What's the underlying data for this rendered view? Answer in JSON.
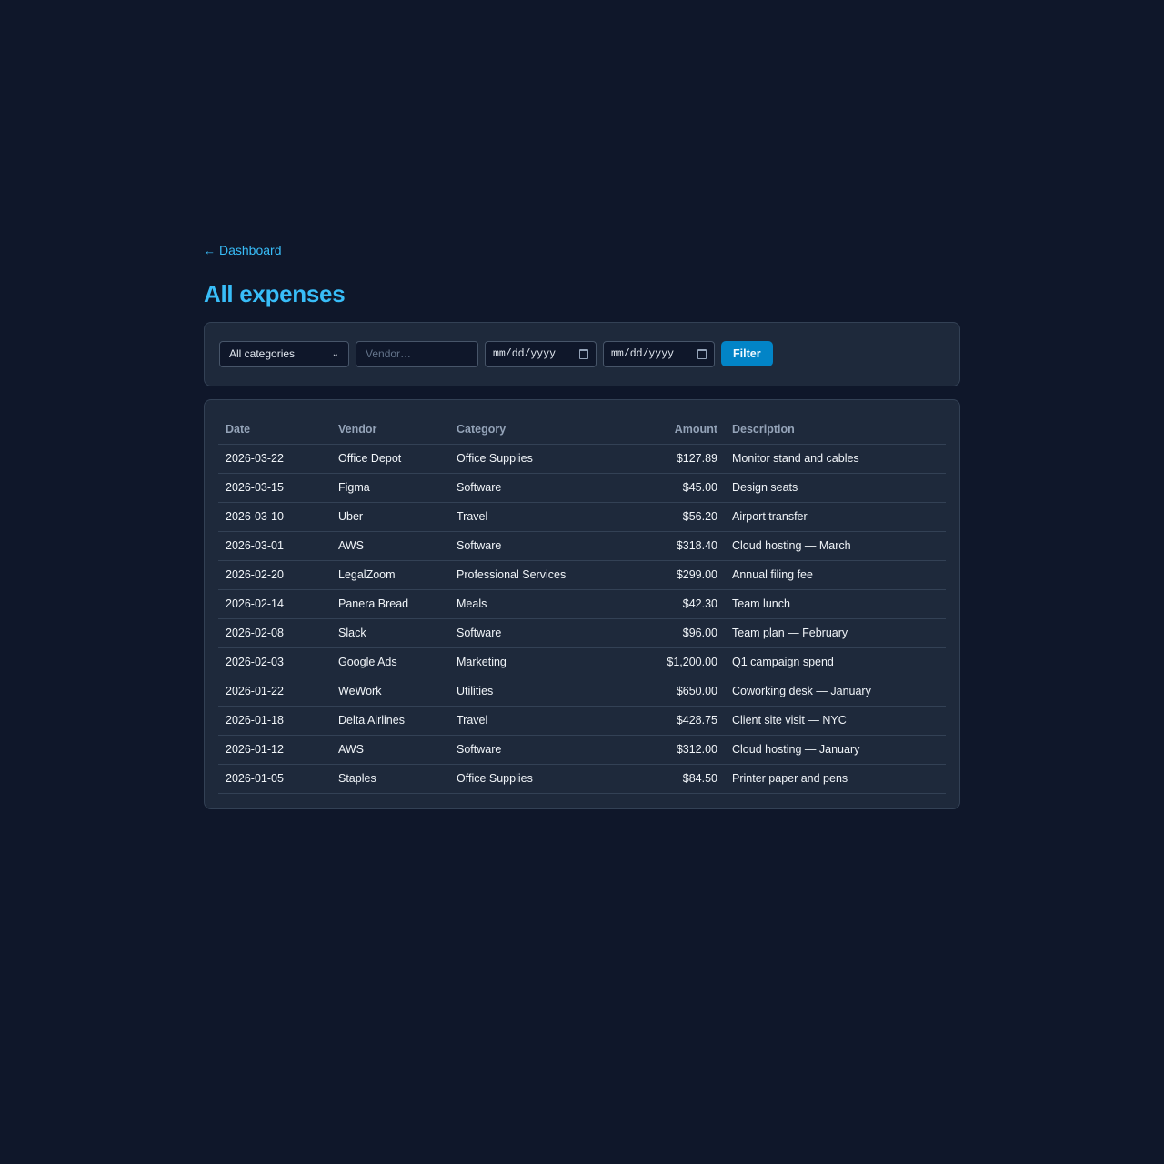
{
  "nav": {
    "back_label": "Dashboard",
    "back_icon": "arrow-left-icon"
  },
  "page": {
    "title": "All expenses"
  },
  "filters": {
    "category_selected": "All categories",
    "vendor_placeholder": "Vendor…",
    "date_from_placeholder": "mm/dd/yyyy",
    "date_to_placeholder": "mm/dd/yyyy",
    "filter_button": "Filter"
  },
  "table": {
    "headers": {
      "date": "Date",
      "vendor": "Vendor",
      "category": "Category",
      "amount": "Amount",
      "description": "Description"
    },
    "rows": [
      {
        "date": "2026-03-22",
        "vendor": "Office Depot",
        "category": "Office Supplies",
        "amount": "$127.89",
        "description": "Monitor stand and cables"
      },
      {
        "date": "2026-03-15",
        "vendor": "Figma",
        "category": "Software",
        "amount": "$45.00",
        "description": "Design seats"
      },
      {
        "date": "2026-03-10",
        "vendor": "Uber",
        "category": "Travel",
        "amount": "$56.20",
        "description": "Airport transfer"
      },
      {
        "date": "2026-03-01",
        "vendor": "AWS",
        "category": "Software",
        "amount": "$318.40",
        "description": "Cloud hosting — March"
      },
      {
        "date": "2026-02-20",
        "vendor": "LegalZoom",
        "category": "Professional Services",
        "amount": "$299.00",
        "description": "Annual filing fee"
      },
      {
        "date": "2026-02-14",
        "vendor": "Panera Bread",
        "category": "Meals",
        "amount": "$42.30",
        "description": "Team lunch"
      },
      {
        "date": "2026-02-08",
        "vendor": "Slack",
        "category": "Software",
        "amount": "$96.00",
        "description": "Team plan — February"
      },
      {
        "date": "2026-02-03",
        "vendor": "Google Ads",
        "category": "Marketing",
        "amount": "$1,200.00",
        "description": "Q1 campaign spend"
      },
      {
        "date": "2026-01-22",
        "vendor": "WeWork",
        "category": "Utilities",
        "amount": "$650.00",
        "description": "Coworking desk — January"
      },
      {
        "date": "2026-01-18",
        "vendor": "Delta Airlines",
        "category": "Travel",
        "amount": "$428.75",
        "description": "Client site visit — NYC"
      },
      {
        "date": "2026-01-12",
        "vendor": "AWS",
        "category": "Software",
        "amount": "$312.00",
        "description": "Cloud hosting — January"
      },
      {
        "date": "2026-01-05",
        "vendor": "Staples",
        "category": "Office Supplies",
        "amount": "$84.50",
        "description": "Printer paper and pens"
      }
    ]
  },
  "colors": {
    "background": "#0f172a",
    "card": "#1e293b",
    "accent": "#38bdf8",
    "button": "#0284c7"
  }
}
